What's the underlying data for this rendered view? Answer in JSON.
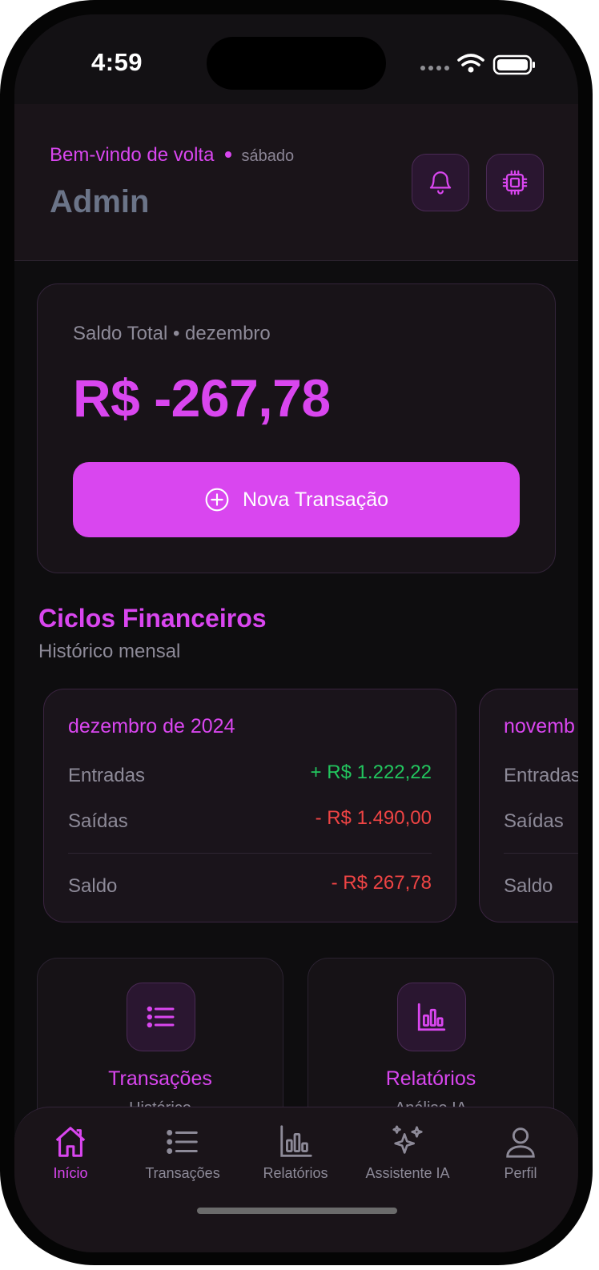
{
  "status": {
    "time": "4:59"
  },
  "header": {
    "welcome": "Bem-vindo de volta",
    "day": "sábado",
    "user": "Admin",
    "icons": [
      "bell-icon",
      "chip-icon"
    ]
  },
  "balance": {
    "label": "Saldo Total • dezembro",
    "value": "R$ -267,78",
    "button": "Nova Transação"
  },
  "cycles": {
    "title": "Ciclos Financeiros",
    "subtitle": "Histórico mensal",
    "items": [
      {
        "month": "dezembro de 2024",
        "entradas_label": "Entradas",
        "entradas": "+ R$ 1.222,22",
        "saidas_label": "Saídas",
        "saidas": "- R$ 1.490,00",
        "saldo_label": "Saldo",
        "saldo": "- R$ 267,78"
      },
      {
        "month": "novemb",
        "entradas_label": "Entradas",
        "saidas_label": "Saídas",
        "saldo_label": "Saldo"
      }
    ]
  },
  "tiles": [
    {
      "title": "Transações",
      "subtitle": "Histórico",
      "icon": "list-icon"
    },
    {
      "title": "Relatórios",
      "subtitle": "Análise IA",
      "icon": "bar-chart-icon"
    }
  ],
  "tabbar": {
    "items": [
      {
        "label": "Início",
        "icon": "home-icon",
        "active": true
      },
      {
        "label": "Transações",
        "icon": "list-icon",
        "active": false
      },
      {
        "label": "Relatórios",
        "icon": "bar-chart-icon",
        "active": false
      },
      {
        "label": "Assistente IA",
        "icon": "sparkles-icon",
        "active": false
      },
      {
        "label": "Perfil",
        "icon": "user-icon",
        "active": false
      }
    ]
  },
  "colors": {
    "accent": "#d946ef",
    "positive": "#22c55e",
    "negative": "#ef4444",
    "background": "#0e0d0f",
    "muted": "#8d8a98"
  }
}
